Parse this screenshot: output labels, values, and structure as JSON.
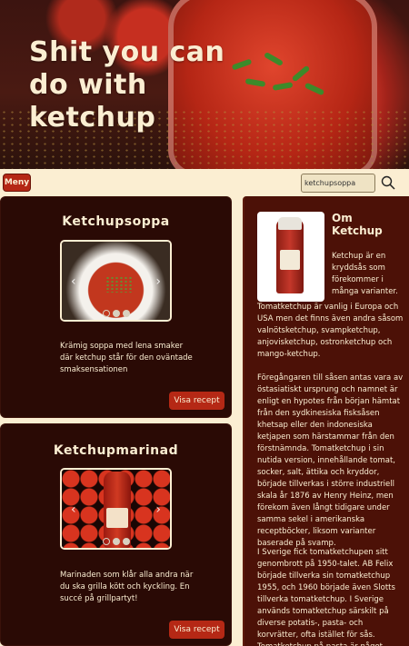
{
  "hero": {
    "title": "Shit you can do with ketchup"
  },
  "nav": {
    "menu_label": "Meny",
    "search_value": "ketchupsoppa"
  },
  "cards": [
    {
      "title": "Ketchupsoppa",
      "description": "Krämig soppa med lena smaker där ketchup står för den oväntade smaksensationen",
      "button": "Visa recept"
    },
    {
      "title": "Ketchupmarinad",
      "description": "Marinaden som klår alla andra när du ska grilla kött och kyckling. En succé på grillpartyt!",
      "button": "Visa recept"
    }
  ],
  "carousel": {
    "prev_icon": "‹",
    "next_icon": "›"
  },
  "sidebar": {
    "title": "Om Ketchup",
    "intro": "Ketchup är en kryddsås som förekommer i många varianter.",
    "p1": "Tomatketchup är vanlig i Europa och USA men det finns även andra såsom valnötsketchup, svampketchup, anjovisketchup, ostronketchup och mango-ketchup.",
    "p2": "Föregångaren till såsen antas vara av östasiatiskt ursprung och namnet är enligt en hypotes från början hämtat från den sydkinesiska fisksåsen khetsap eller den indonesiska ketjapen som härstammar från den förstnämnda. Tomatketchup i sin nutida version, innehållande tomat, socker, salt, ättika och kryddor, började tillverkas i större industriell skala år 1876 av Henry Heinz, men förekom även långt tidigare under samma sekel i amerikanska receptböcker, liksom varianter baserade på svamp.",
    "p3": "I Sverige fick tomatketchupen sitt genombrott på 1950-talet. AB Felix började tillverka sin tomatketchup 1955, och 1960 började även Slotts tillverka tomatketchup. I Sverige används tomatketchup särskilt på diverse potatis-, pasta- och korvrätter, ofta istället för sås. Tomatketchup på pasta är något"
  },
  "colors": {
    "accent": "#b52815",
    "cream": "#fbeed2",
    "card_bg": "#2a0a05",
    "sidebar_bg": "#4c1107"
  }
}
